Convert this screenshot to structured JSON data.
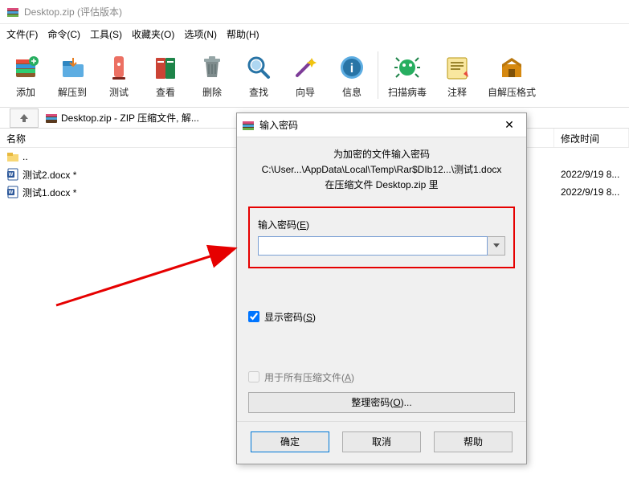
{
  "title": "Desktop.zip (评估版本)",
  "menu": [
    "文件(F)",
    "命令(C)",
    "工具(S)",
    "收藏夹(O)",
    "选项(N)",
    "帮助(H)"
  ],
  "toolbar": [
    {
      "label": "添加"
    },
    {
      "label": "解压到"
    },
    {
      "label": "测试"
    },
    {
      "label": "查看"
    },
    {
      "label": "删除"
    },
    {
      "label": "查找"
    },
    {
      "label": "向导"
    },
    {
      "label": "信息"
    },
    {
      "label": "扫描病毒"
    },
    {
      "label": "注释"
    },
    {
      "label": "自解压格式"
    }
  ],
  "address": {
    "path": "Desktop.zip - ZIP 压缩文件, 解..."
  },
  "columns": {
    "name": "名称",
    "date": "修改时间"
  },
  "files": [
    {
      "name": "..",
      "type": "folder",
      "date": ""
    },
    {
      "name": "测试2.docx *",
      "type": "docx",
      "date": "2022/9/19 8..."
    },
    {
      "name": "测试1.docx *",
      "type": "docx",
      "date": "2022/9/19 8..."
    }
  ],
  "dialog": {
    "title": "输入密码",
    "head1": "为加密的文件输入密码",
    "head2": "C:\\User...\\AppData\\Local\\Temp\\Rar$DIb12...\\测试1.docx",
    "head3": "在压缩文件 Desktop.zip 里",
    "pw_label": "输入密码(",
    "pw_key": "E",
    "pw_label_end": ")",
    "show_pw": "显示密码(",
    "show_pw_key": "S",
    "show_pw_end": ")",
    "all_files": "用于所有压缩文件(",
    "all_files_key": "A",
    "all_files_end": ")",
    "organize": "整理密码(",
    "organize_key": "O",
    "organize_end": ")...",
    "ok": "确定",
    "cancel": "取消",
    "help": "帮助"
  }
}
